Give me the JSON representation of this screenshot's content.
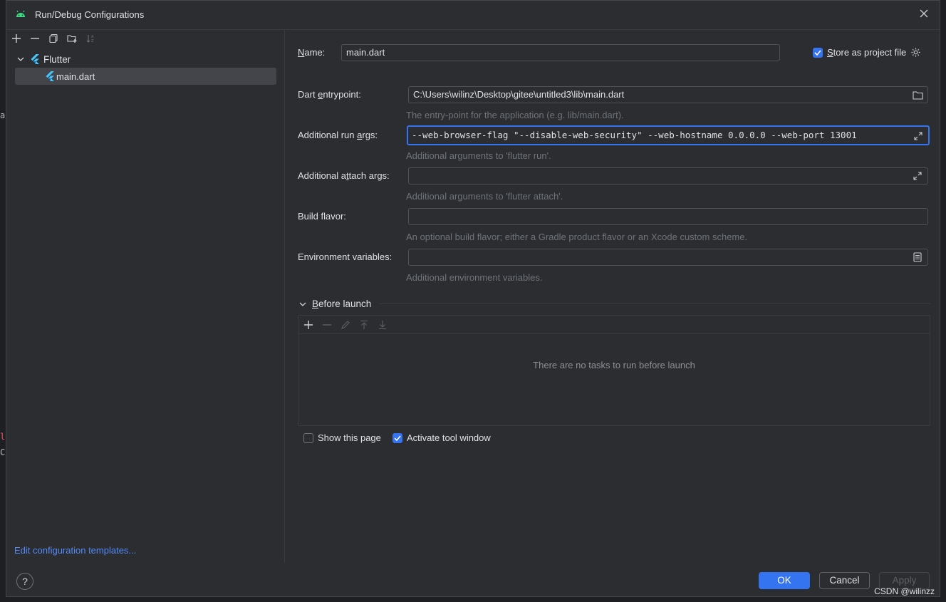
{
  "window": {
    "title": "Run/Debug Configurations"
  },
  "tree": {
    "group_label": "Flutter",
    "item_label": "main.dart"
  },
  "left_footer": {
    "edit_templates": "Edit configuration templates..."
  },
  "form": {
    "name_label_u": "N",
    "name_label_rest": "ame:",
    "name_value": "main.dart",
    "store_label_u": "S",
    "store_label_rest": "tore as project file",
    "entry_label_a": "Dart ",
    "entry_label_u": "e",
    "entry_label_b": "ntrypoint:",
    "entry_value": "C:\\Users\\wilinz\\Desktop\\gitee\\untitled3\\lib\\main.dart",
    "entry_hint": "The entry-point for the application (e.g. lib/main.dart).",
    "run_label_a": "Additional run ",
    "run_label_u": "a",
    "run_label_b": "rgs:",
    "run_value": "--web-browser-flag \"--disable-web-security\" --web-hostname 0.0.0.0 --web-port 13001",
    "run_hint": "Additional arguments to 'flutter run'.",
    "attach_label_a": "Additional a",
    "attach_label_u": "t",
    "attach_label_b": "tach args:",
    "attach_value": "",
    "attach_hint": "Additional arguments to 'flutter attach'.",
    "flavor_label": "Build flavor:",
    "flavor_value": "",
    "flavor_hint": "An optional build flavor; either a Gradle product flavor or an Xcode custom scheme.",
    "env_label": "Environment variables:",
    "env_value": "",
    "env_hint": "Additional environment variables."
  },
  "before_launch": {
    "title_u": "B",
    "title_rest": "efore launch",
    "empty_text": "There are no tasks to run before launch"
  },
  "options": {
    "show_page_label": "Show this page",
    "show_page_checked": false,
    "activate_tool_label": "Activate tool window",
    "activate_tool_checked": true
  },
  "footer": {
    "help": "?",
    "ok": "OK",
    "cancel": "Cancel",
    "apply": "Apply"
  },
  "watermark": "CSDN @wilinzz",
  "background_fragments": [
    "ar",
    "l",
    "C"
  ],
  "colors": {
    "accent": "#3574f0",
    "link": "#548af7",
    "flutter_blue": "#47c5fb",
    "android_green": "#3ddc84"
  }
}
